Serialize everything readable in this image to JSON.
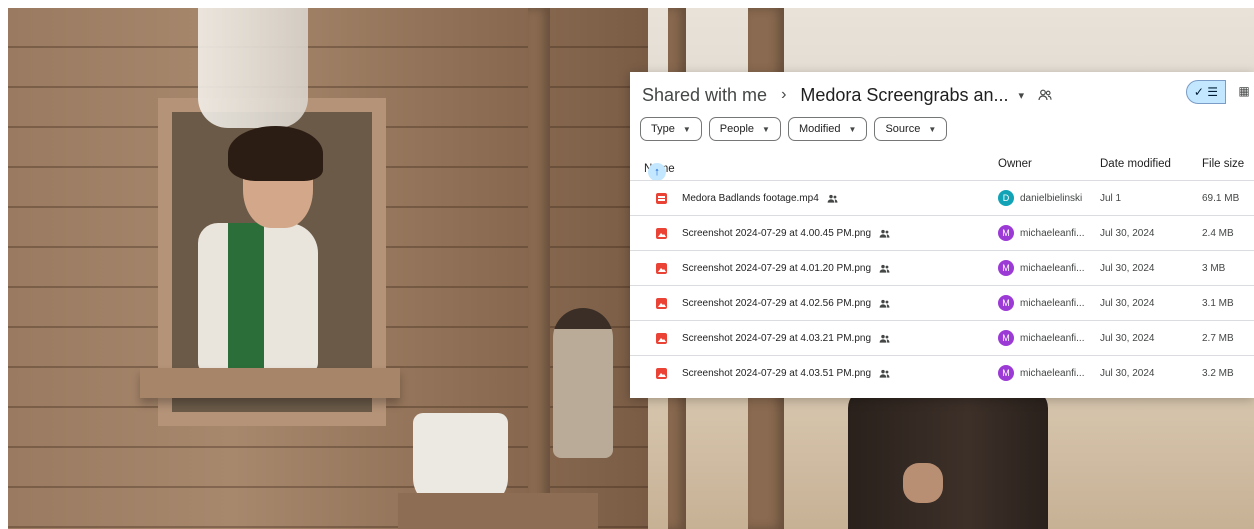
{
  "breadcrumb": {
    "root": "Shared with me",
    "separator": "›",
    "current": "Medora Screengrabs an...",
    "caret": "▾"
  },
  "view_toggle": {
    "list_label": "✓ ☰",
    "grid_label": "▦"
  },
  "filters": [
    {
      "label": "Type"
    },
    {
      "label": "People"
    },
    {
      "label": "Modified"
    },
    {
      "label": "Source"
    }
  ],
  "columns": {
    "name": "Name",
    "sort_arrow": "↑",
    "owner": "Owner",
    "date_modified": "Date modified",
    "file_size": "File size"
  },
  "files": [
    {
      "name": "Medora Badlands footage.mp4",
      "icon": "video-file-icon",
      "owner": "danielbielinski",
      "avatar_letter": "D",
      "avatar_color": "#12a3b7",
      "date": "Jul 1",
      "size": "69.1 MB"
    },
    {
      "name": "Screenshot 2024-07-29 at 4.00.45 PM.png",
      "icon": "image-file-icon",
      "owner": "michaeleanfi...",
      "avatar_letter": "M",
      "avatar_color": "#9c3ad6",
      "date": "Jul 30, 2024",
      "size": "2.4 MB"
    },
    {
      "name": "Screenshot 2024-07-29 at 4.01.20 PM.png",
      "icon": "image-file-icon",
      "owner": "michaeleanfi...",
      "avatar_letter": "M",
      "avatar_color": "#9c3ad6",
      "date": "Jul 30, 2024",
      "size": "3 MB"
    },
    {
      "name": "Screenshot 2024-07-29 at 4.02.56 PM.png",
      "icon": "image-file-icon",
      "owner": "michaeleanfi...",
      "avatar_letter": "M",
      "avatar_color": "#9c3ad6",
      "date": "Jul 30, 2024",
      "size": "3.1 MB"
    },
    {
      "name": "Screenshot 2024-07-29 at 4.03.21 PM.png",
      "icon": "image-file-icon",
      "owner": "michaeleanfi...",
      "avatar_letter": "M",
      "avatar_color": "#9c3ad6",
      "date": "Jul 30, 2024",
      "size": "2.7 MB"
    },
    {
      "name": "Screenshot 2024-07-29 at 4.03.51 PM.png",
      "icon": "image-file-icon",
      "owner": "michaeleanfi...",
      "avatar_letter": "M",
      "avatar_color": "#9c3ad6",
      "date": "Jul 30, 2024",
      "size": "3.2 MB"
    }
  ]
}
